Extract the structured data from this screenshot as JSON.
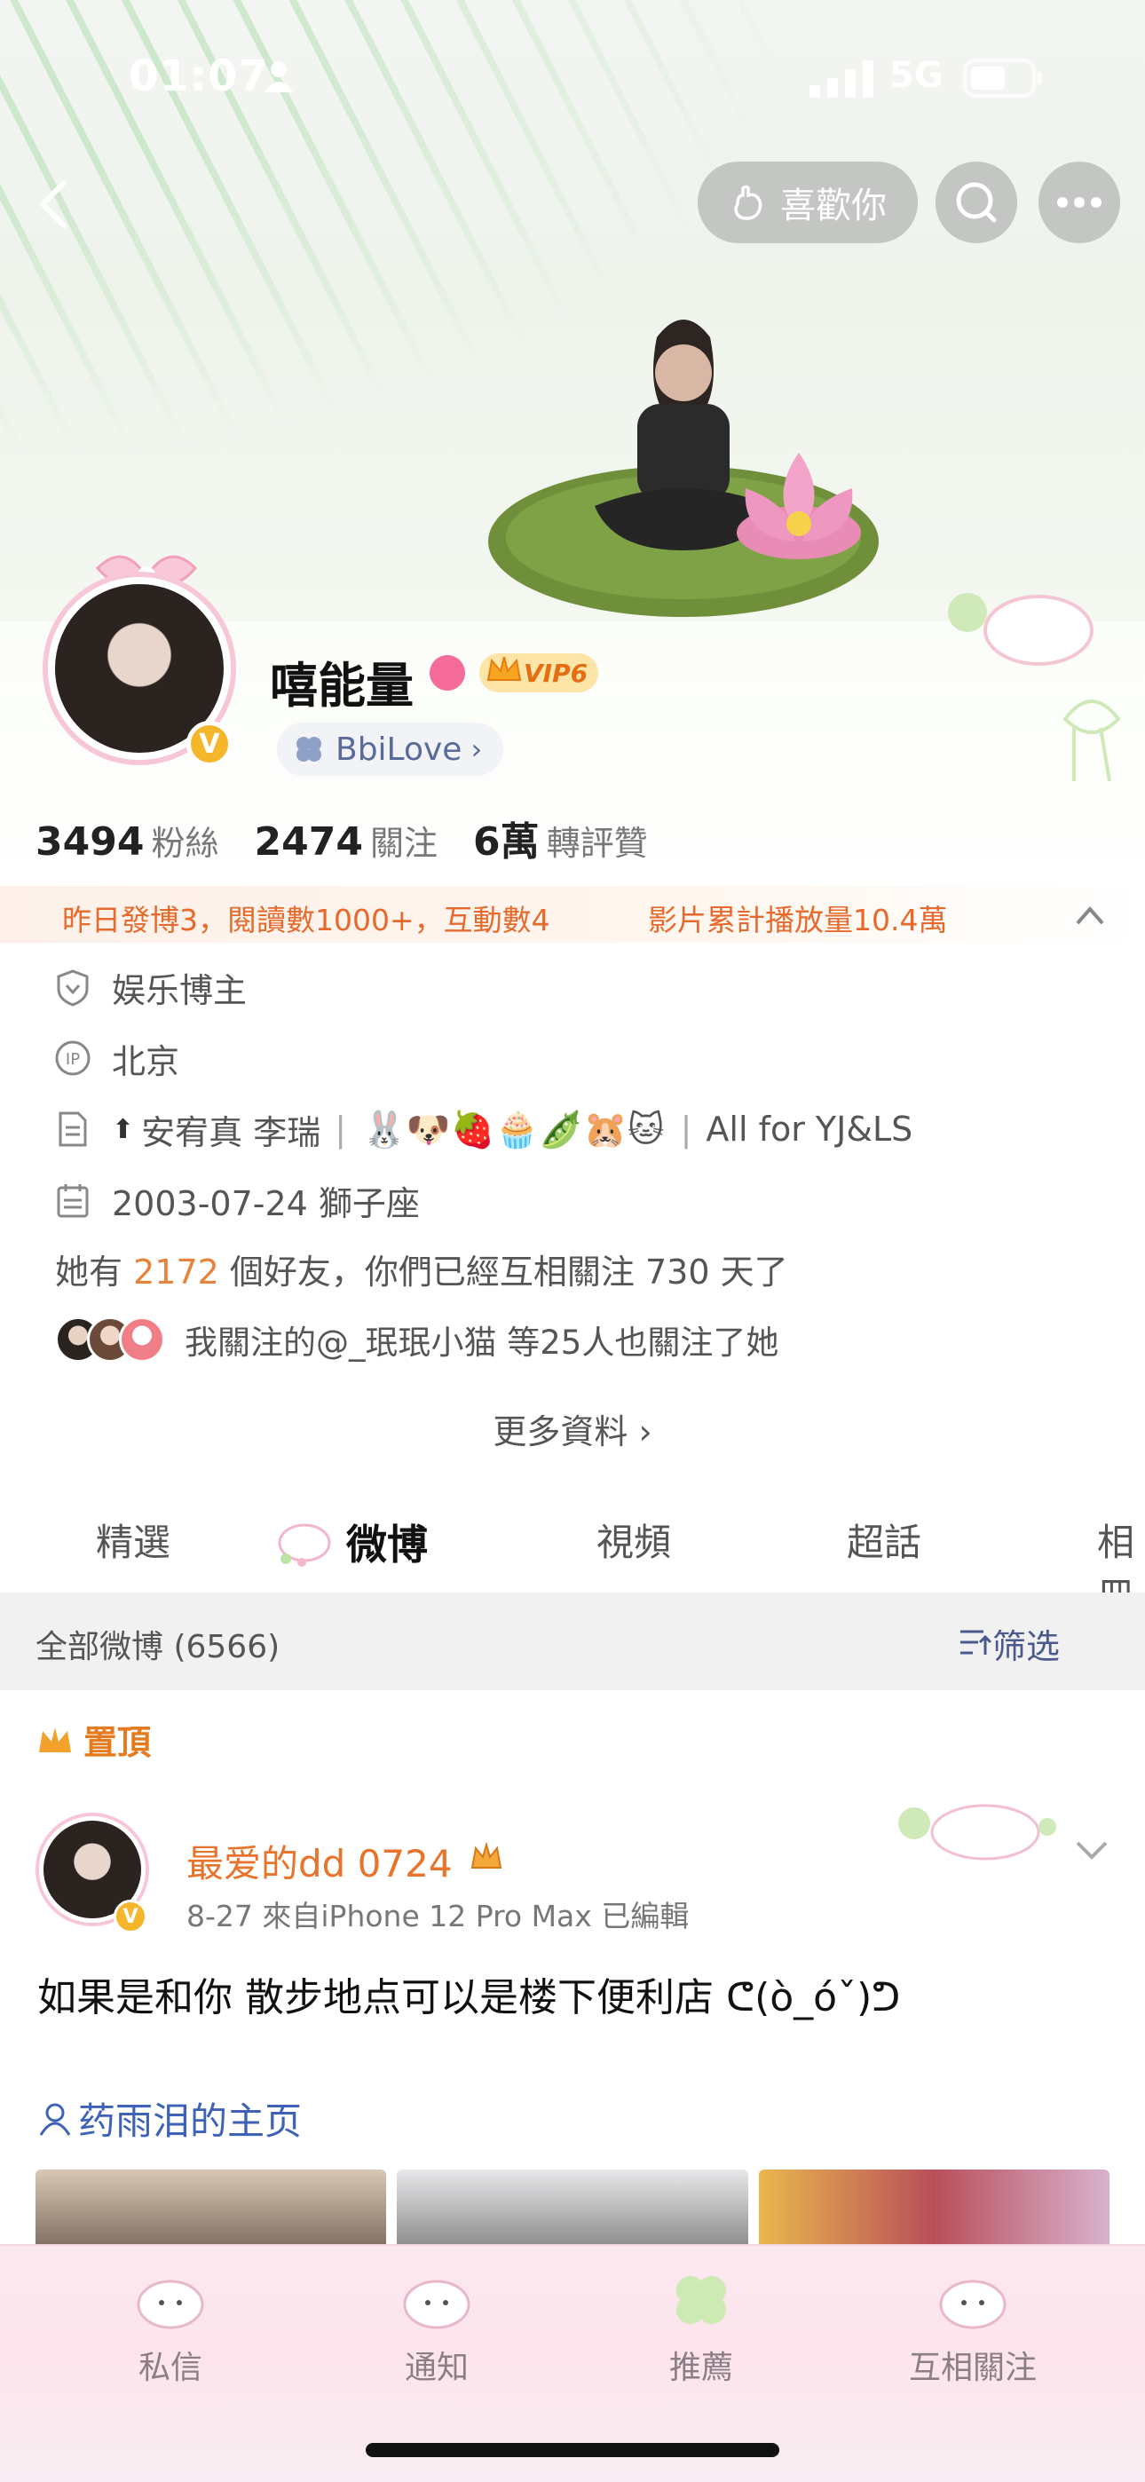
{
  "status_bar": {
    "time": "01:07",
    "network": "5G"
  },
  "header": {
    "like_button": "喜歡你"
  },
  "profile": {
    "name": "嘻能量",
    "vip": "VIP6",
    "group_tag": "BbiLove",
    "stats": [
      {
        "value": "3494",
        "label": "粉絲"
      },
      {
        "value": "2474",
        "label": "關注"
      },
      {
        "value": "6萬",
        "label": "轉評贊"
      }
    ],
    "activity_left": "昨日發博3，閱讀數1000+，互動數4",
    "activity_right": "影片累計播放量10.4萬",
    "category": "娱乐博主",
    "location": "北京",
    "bio_prefix": "安宥真 李瑞",
    "bio_emojis": "🐰🐶🍓🧁🫛🐹🐱",
    "bio_suffix": "All for YJ&LS",
    "birthday": "2003-07-24 獅子座",
    "friends_prefix": "她有 ",
    "friends_count": "2172",
    "friends_suffix": " 個好友，你們已經互相關注 730 天了",
    "mutual_follow": "我關注的@_珉珉小猫 等25人也關注了她",
    "more_info": "更多資料"
  },
  "tabs": [
    "精選",
    "微博",
    "視頻",
    "超話",
    "相冊"
  ],
  "list": {
    "title": "全部微博 (6566)",
    "filter": "筛选"
  },
  "post": {
    "pinned_label": "置頂",
    "author": "最爱的dd 0724",
    "meta": "8-27  來自iPhone 12 Pro Max  已編輯",
    "text": "如果是和你 散步地点可以是楼下便利店 ᕦ(ò_óˇ)ᕤ",
    "link": "药雨泪的主页"
  },
  "bottom_nav": [
    "私信",
    "通知",
    "推薦",
    "互相關注"
  ],
  "colors": {
    "accent_orange": "#e8732a",
    "link_blue": "#3d62b8",
    "vip_gold": "#f6b62c",
    "pink_bar": "#fde4ec"
  }
}
